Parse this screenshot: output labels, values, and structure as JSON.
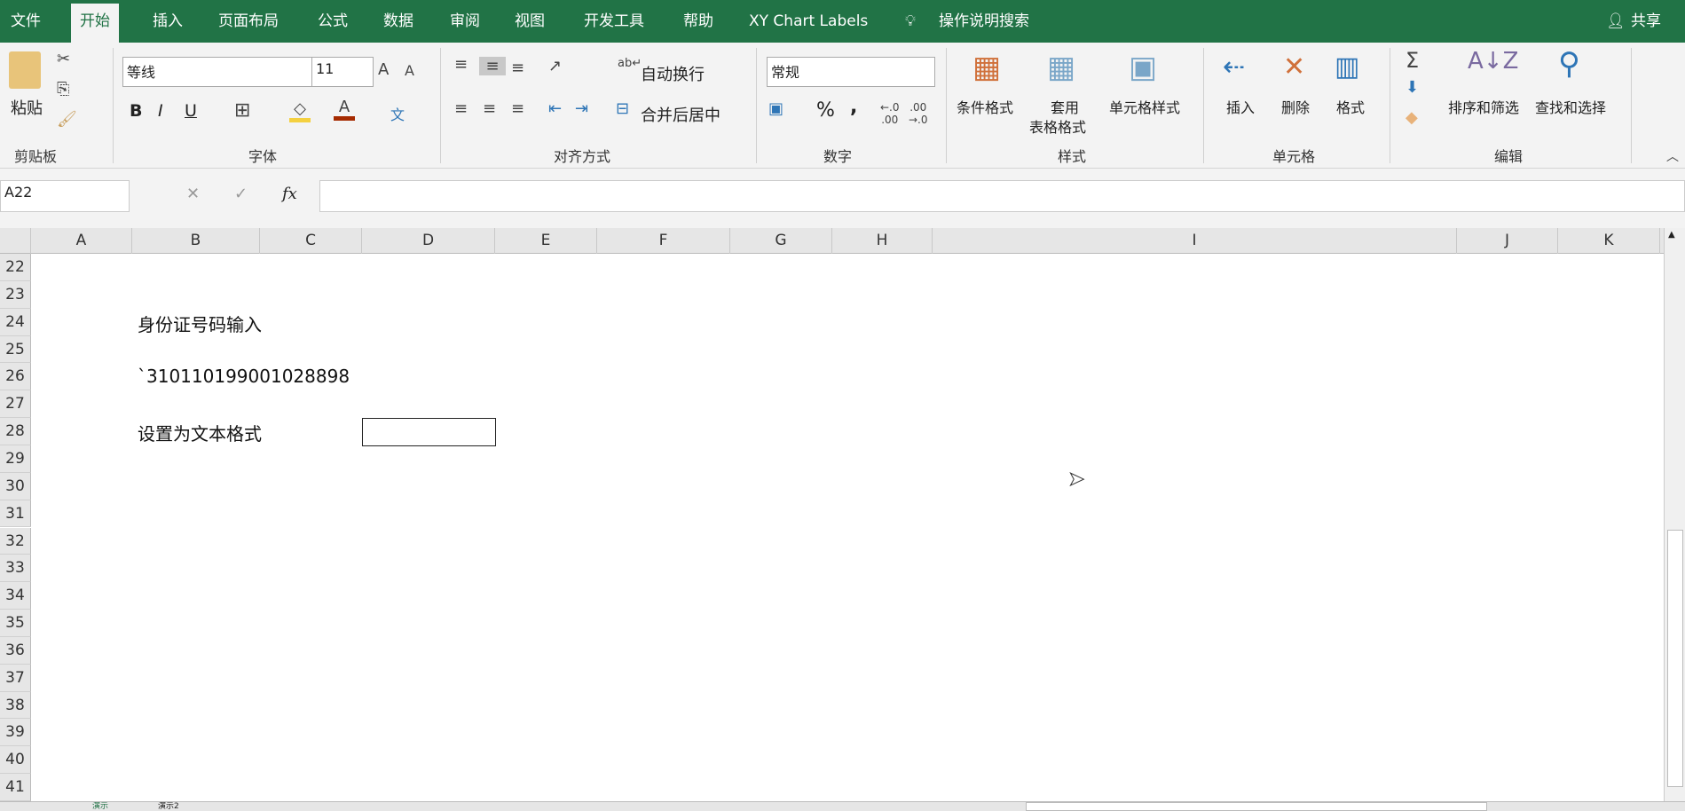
{
  "tabs": [
    "文件",
    "开始",
    "插入",
    "页面布局",
    "公式",
    "数据",
    "审阅",
    "视图",
    "开发工具",
    "帮助",
    "XY Chart Labels"
  ],
  "tell_me": "操作说明搜索",
  "share": "共享",
  "ribbon": {
    "clipboard": {
      "paste": "粘贴",
      "group": "剪贴板"
    },
    "font": {
      "name": "等线",
      "size": "11",
      "group": "字体",
      "bold": "B",
      "italic": "I",
      "underline": "U",
      "phonetic": "文"
    },
    "alignment": {
      "wrap": "自动换行",
      "merge": "合并后居中",
      "group": "对齐方式"
    },
    "number": {
      "format": "常规",
      "percent": "%",
      "comma": ",",
      "group": "数字"
    },
    "styles": {
      "conditional": "条件格式",
      "table_line1": "套用",
      "table_line2": "表格格式",
      "cell_styles": "单元格样式",
      "group": "样式"
    },
    "cells": {
      "insert": "插入",
      "delete": "删除",
      "format": "格式",
      "group": "单元格"
    },
    "editing": {
      "sort": "排序和筛选",
      "find": "查找和选择",
      "group": "编辑"
    }
  },
  "formula_bar": {
    "name_box": "A22",
    "fx": "fx",
    "value": ""
  },
  "columns": [
    "A",
    "B",
    "C",
    "D",
    "E",
    "F",
    "G",
    "H",
    "I",
    "J",
    "K"
  ],
  "rows": [
    "22",
    "23",
    "24",
    "25",
    "26",
    "27",
    "28",
    "29",
    "30",
    "31",
    "32",
    "33",
    "34",
    "35",
    "36",
    "37",
    "38",
    "39",
    "40",
    "41"
  ],
  "cells": {
    "B24": "身份证号码输入",
    "B26": "`310110199001028898",
    "B28": "设置为文本格式"
  },
  "sheets": [
    "演示",
    "演示2"
  ]
}
